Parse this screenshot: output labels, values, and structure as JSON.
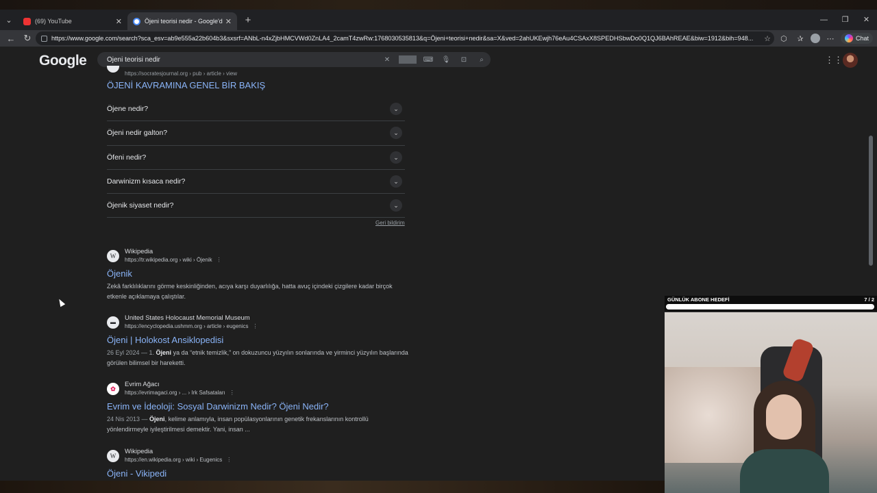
{
  "tabs": [
    {
      "title": "(69) YouTube",
      "icon": "youtube-icon"
    },
    {
      "title": "Öjeni teorisi nedir - Google'da Ara",
      "icon": "google-icon"
    }
  ],
  "address_bar": {
    "url": "https://www.google.com/search?sca_esv=ab9e555a22b604b3&sxsrf=ANbL-n4xZjbHMCVWd0ZnLA4_2camT4zwRw:1768030535813&q=Öjeni+teorisi+nedir&sa=X&ved=2ahUKEwjh76eAu4CSAxX8SPEDHSbwDo0Q1QJ6BAhREAE&biw=1912&bih=948..."
  },
  "toolbar": {
    "chat_label": "Chat"
  },
  "google": {
    "logo": "Google",
    "query": "Öjeni teorisi nedir"
  },
  "prev_result": {
    "url": "https://socratesjournal.org › pub › article › view",
    "title": "ÖJENİ KAVRAMINA GENEL BİR BAKIŞ"
  },
  "related_questions": [
    "Öjene nedir?",
    "Öjeni nedir galton?",
    "Öfeni nedir?",
    "Darwinizm kısaca nedir?",
    "Öjenik siyaset nedir?"
  ],
  "feedback_label": "Geri bildirim",
  "results": [
    {
      "favicon": "W",
      "site": "Wikipedia",
      "url": "https://tr.wikipedia.org › wiki › Öjenik",
      "title": "Öjenik",
      "date": "",
      "snippet_bold": "",
      "snippet": "Zekâ farklılıklarını görme keskinliğinden, acıya karşı duyarlılığa, hatta avuç içindeki çizgilere kadar birçok etkenle açıklamaya çalıştılar."
    },
    {
      "favicon": "▬",
      "site": "United States Holocaust Memorial Museum",
      "url": "https://encyclopedia.ushmm.org › article › eugenics",
      "title": "Öjeni | Holokost Ansiklopedisi",
      "date": "26 Eyl 2024 — 1. ",
      "snippet_bold": "Öjeni",
      "snippet": " ya da “etnik temizlik,” on dokuzuncu yüzyılın sonlarında ve yirminci yüzyılın başlarında görülen bilimsel bir hareketti."
    },
    {
      "favicon": "✿",
      "site": "Evrim Ağacı",
      "url": "https://evrimagaci.org › ... › Irk Safsataları",
      "title": "Evrim ve İdeoloji: Sosyal Darwinizm Nedir? Öjeni Nedir?",
      "date": "24 Nis 2013 — ",
      "snippet_bold": "Öjeni",
      "snippet": ", kelime anlamıyla, insan popülasyonlarının genetik frekanslarının kontrollü yönlendirmeyle iyileştirilmesi demektir. Yani, insan ..."
    },
    {
      "favicon": "W",
      "site": "Wikipedia",
      "url": "https://en.wikipedia.org › wiki › Eugenics",
      "title": "Öjeni - Vikipedi",
      "date": "",
      "snippet_bold": "",
      "snippet": ""
    }
  ],
  "overlay": {
    "goal_label": "GÜNLÜK ABONE HEDEFİ",
    "goal_count": "7 / 2",
    "goal_progress": 1.0
  }
}
